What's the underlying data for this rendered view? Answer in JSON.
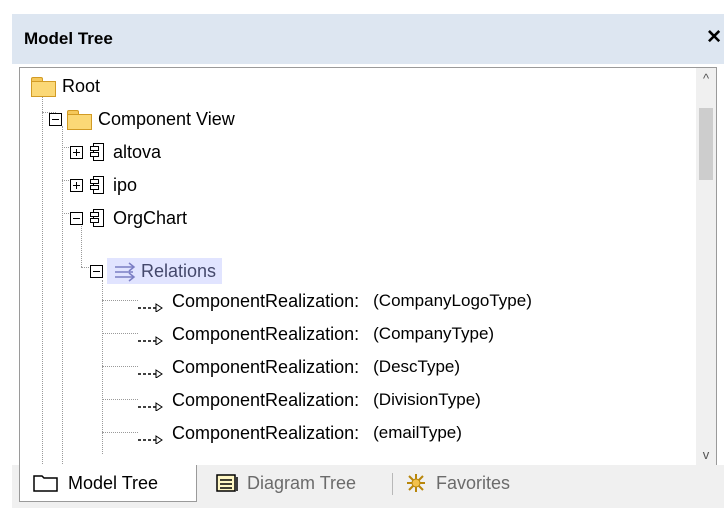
{
  "window": {
    "title": "Model Tree",
    "close_symbol": "✕"
  },
  "tree": {
    "root": "Root",
    "component_view": "Component View",
    "altova": "altova",
    "ipo": "ipo",
    "orgchart": "OrgChart",
    "relations": "Relations",
    "realizations": [
      {
        "label": "ComponentRealization:",
        "type": "(CompanyLogoType)"
      },
      {
        "label": "ComponentRealization:",
        "type": "(CompanyType)"
      },
      {
        "label": "ComponentRealization:",
        "type": "(DescType)"
      },
      {
        "label": "ComponentRealization:",
        "type": "(DivisionType)"
      },
      {
        "label": "ComponentRealization:",
        "type": "(emailType)"
      }
    ]
  },
  "scrollbar": {
    "up": "^",
    "down": "v"
  },
  "tabs": [
    {
      "label": "Model Tree",
      "active": true,
      "icon": "folder-icon"
    },
    {
      "label": "Diagram Tree",
      "active": false,
      "icon": "diagram-tree-icon"
    },
    {
      "label": "Favorites",
      "active": false,
      "icon": "favorites-star-icon"
    }
  ],
  "colors": {
    "titlebar": "#dde6f1",
    "selection": "#e1e4ff",
    "folder": "#fbd876"
  }
}
